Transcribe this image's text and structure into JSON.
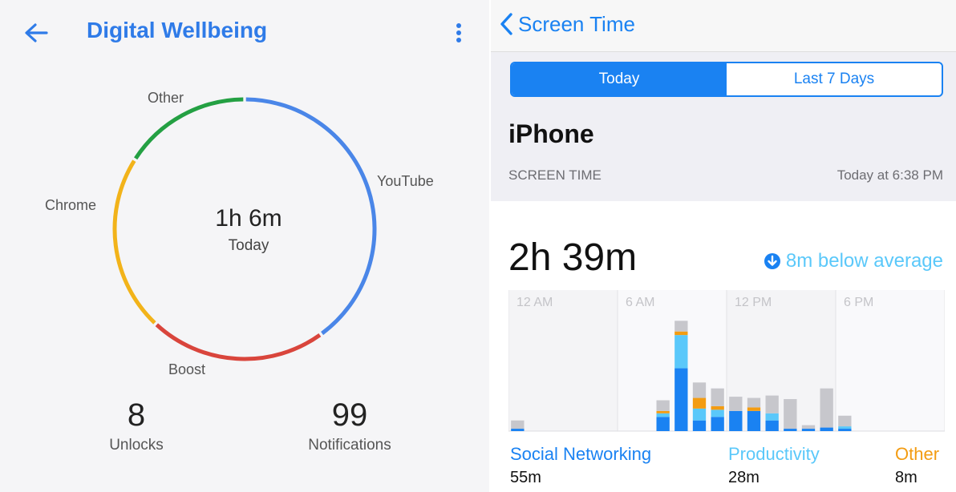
{
  "digital_wellbeing": {
    "title": "Digital Wellbeing",
    "donut": {
      "center_time": "1h 6m",
      "center_label": "Today",
      "segments": [
        {
          "label": "YouTube",
          "color": "#4a86e8",
          "fraction": 0.4
        },
        {
          "label": "Boost",
          "color": "#d9453c",
          "fraction": 0.22
        },
        {
          "label": "Chrome",
          "color": "#f2b31a",
          "fraction": 0.22
        },
        {
          "label": "Other",
          "color": "#24a043",
          "fraction": 0.16
        }
      ]
    },
    "stats": {
      "unlocks_value": "8",
      "unlocks_label": "Unlocks",
      "notifications_value": "99",
      "notifications_label": "Notifications"
    }
  },
  "screen_time": {
    "nav_title": "Screen Time",
    "tabs": {
      "today": "Today",
      "last7": "Last 7 Days",
      "selected": "today"
    },
    "device": "iPhone",
    "section_label": "SCREEN TIME",
    "updated": "Today at 6:38 PM",
    "total": "2h 39m",
    "average_note": "8m below average",
    "time_labels": [
      "12 AM",
      "6 AM",
      "12 PM",
      "6 PM"
    ],
    "legend": {
      "social_label": "Social Networking",
      "social_value": "55m",
      "productivity_label": "Productivity",
      "productivity_value": "28m",
      "other_label": "Other",
      "other_value": "8m"
    },
    "colors": {
      "social": "#1a82f2",
      "productivity": "#5ac8fa",
      "other": "#f39c12",
      "misc": "#c7c7cc"
    }
  },
  "chart_data": {
    "type": "bar",
    "x_unit": "hour of day",
    "xticks": [
      "12 AM",
      "6 AM",
      "12 PM",
      "6 PM"
    ],
    "series_order": [
      "Social Networking",
      "Productivity",
      "Other",
      "Uncategorized"
    ],
    "bars": [
      {
        "hour": 0,
        "values": [
          2,
          0,
          0,
          7
        ]
      },
      {
        "hour": 8,
        "values": [
          12,
          3,
          2,
          9
        ]
      },
      {
        "hour": 9,
        "values": [
          53,
          28,
          3,
          9
        ]
      },
      {
        "hour": 10,
        "values": [
          9,
          10,
          9,
          13
        ]
      },
      {
        "hour": 11,
        "values": [
          12,
          6,
          3,
          15
        ]
      },
      {
        "hour": 12,
        "values": [
          17,
          0,
          0,
          12
        ]
      },
      {
        "hour": 13,
        "values": [
          17,
          0,
          3,
          8
        ]
      },
      {
        "hour": 14,
        "values": [
          9,
          6,
          0,
          15
        ]
      },
      {
        "hour": 15,
        "values": [
          2,
          0,
          0,
          25
        ]
      },
      {
        "hour": 16,
        "values": [
          2,
          0,
          0,
          3
        ]
      },
      {
        "hour": 17,
        "values": [
          3,
          0,
          0,
          33
        ]
      },
      {
        "hour": 18,
        "values": [
          2,
          2,
          0,
          9
        ]
      }
    ]
  }
}
